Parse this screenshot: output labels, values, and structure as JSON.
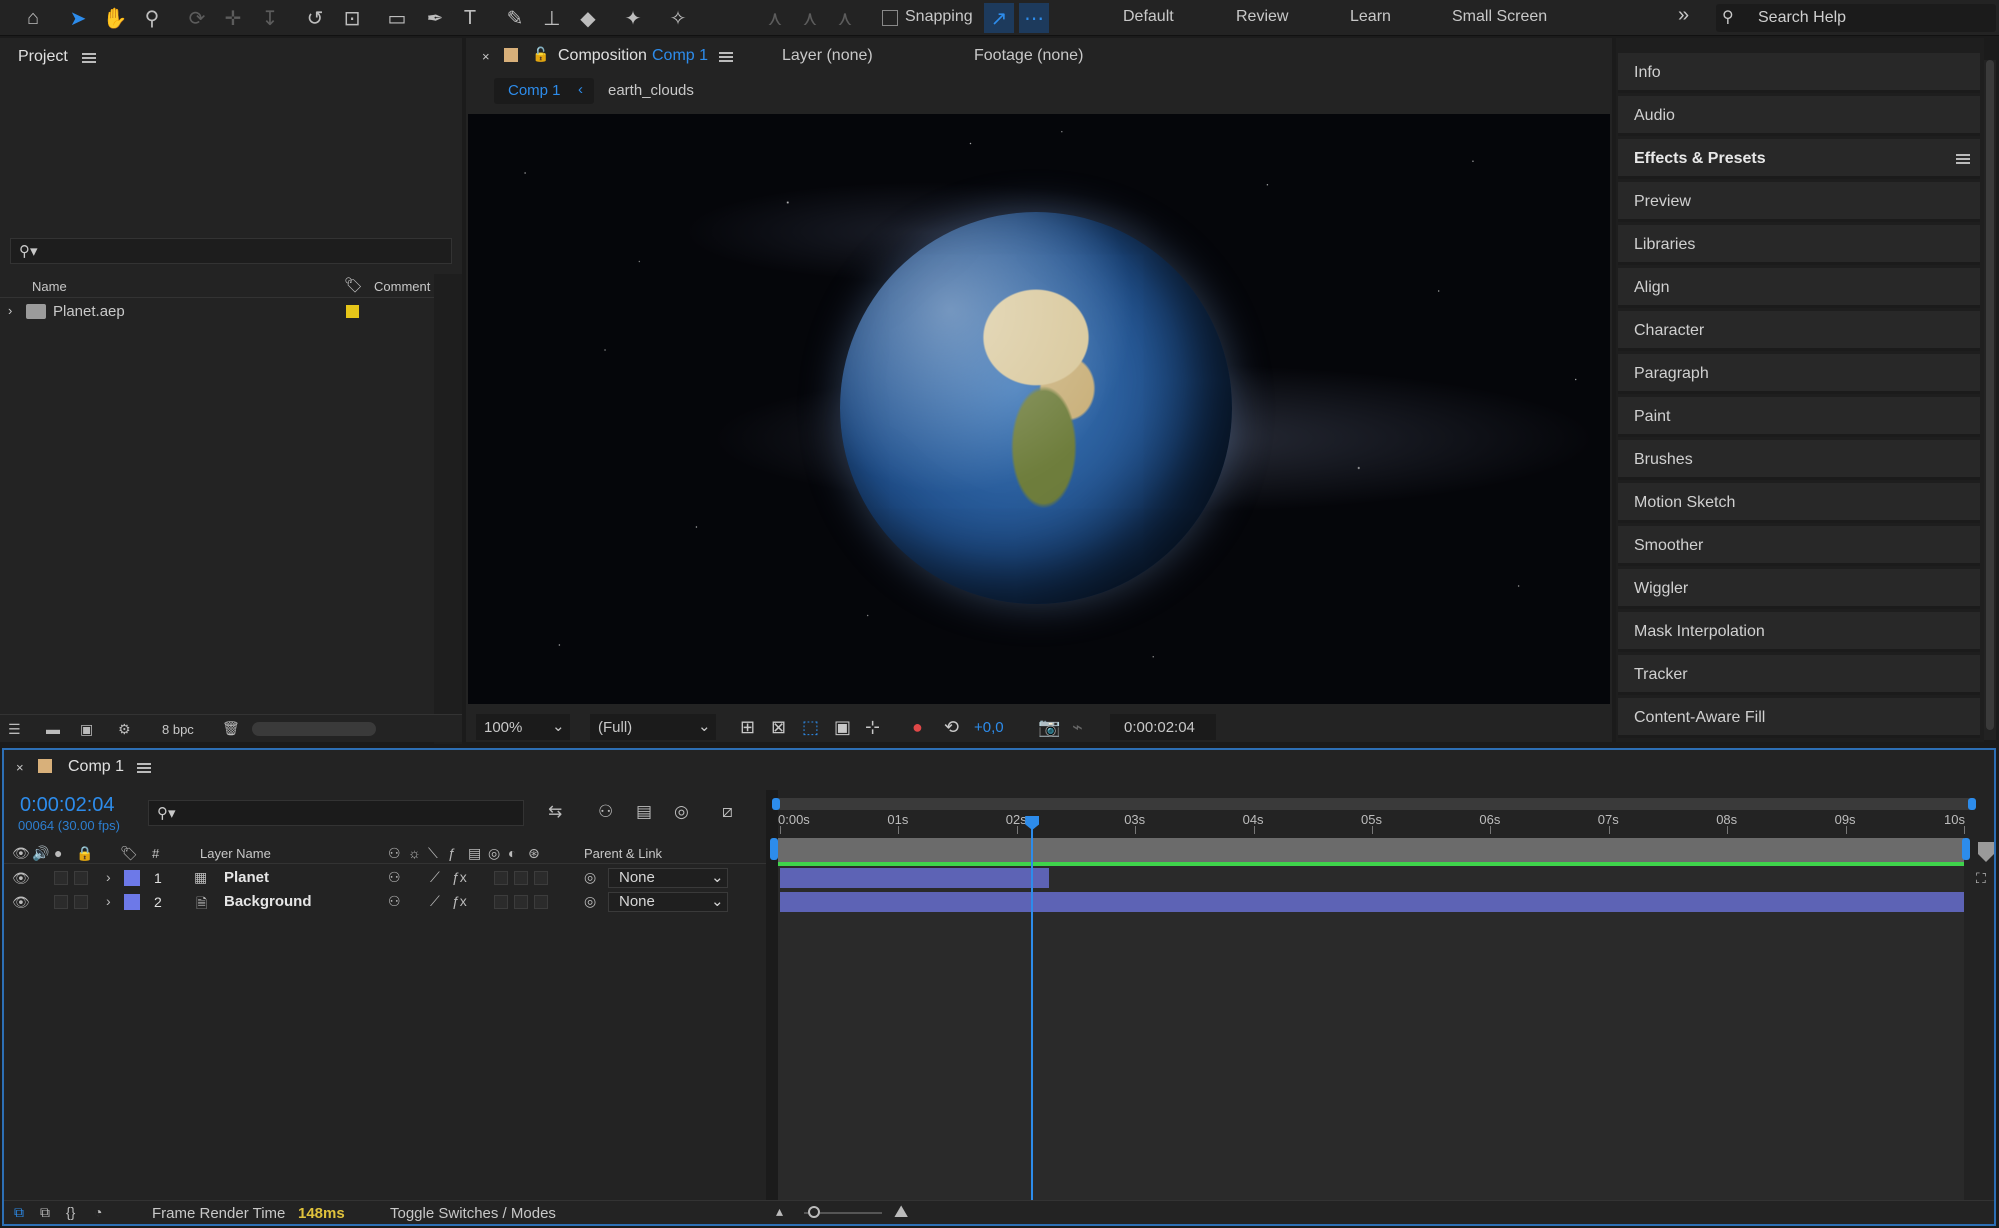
{
  "toolbar": {
    "snapping_label": "Snapping",
    "workspaces": [
      "Default",
      "Review",
      "Learn",
      "Small Screen"
    ],
    "more_label": "»",
    "search_placeholder": "Search Help"
  },
  "project": {
    "title": "Project",
    "columns": {
      "name": "Name",
      "comment": "Comment"
    },
    "items": [
      {
        "name": "Planet.aep",
        "label_color": "#e6c619"
      }
    ],
    "bpc": "8 bpc"
  },
  "composition": {
    "tab_label": "Composition",
    "tab_comp": "Comp 1",
    "layer_tab": "Layer (none)",
    "footage_tab": "Footage (none)",
    "breadcrumb": [
      "Comp 1",
      "earth_clouds"
    ],
    "zoom": "100%",
    "resolution": "(Full)",
    "exposure": "+0,0",
    "timecode": "0:00:02:04"
  },
  "right_panel": {
    "items": [
      "Info",
      "Audio",
      "Effects & Presets",
      "Preview",
      "Libraries",
      "Align",
      "Character",
      "Paragraph",
      "Paint",
      "Brushes",
      "Motion Sketch",
      "Smoother",
      "Wiggler",
      "Mask Interpolation",
      "Tracker",
      "Content-Aware Fill"
    ]
  },
  "timeline": {
    "comp_name": "Comp 1",
    "timecode": "0:00:02:04",
    "frame_info": "00064 (30.00 fps)",
    "columns": {
      "num": "#",
      "layer_name": "Layer Name",
      "parent": "Parent & Link"
    },
    "layers": [
      {
        "num": "1",
        "name": "Planet",
        "parent": "None",
        "color": "#6d79e8"
      },
      {
        "num": "2",
        "name": "Background",
        "parent": "None",
        "color": "#6d79e8"
      }
    ],
    "ruler": [
      "0:00s",
      "01s",
      "02s",
      "03s",
      "04s",
      "05s",
      "06s",
      "07s",
      "08s",
      "09s",
      "10s"
    ],
    "playhead_seconds": 2.13,
    "duration_seconds": 10,
    "layer_bars": [
      {
        "start": 0,
        "end": 2.27
      },
      {
        "start": 0,
        "end": 10
      }
    ]
  },
  "status": {
    "frame_render_label": "Frame Render Time",
    "frame_render_value": "148ms",
    "toggle_label": "Toggle Switches / Modes"
  },
  "colors": {
    "accent": "#2d8ceb",
    "render_value": "#e0c23c",
    "layer_bar": "#5d63b5",
    "work_area": "#3fd34b"
  }
}
